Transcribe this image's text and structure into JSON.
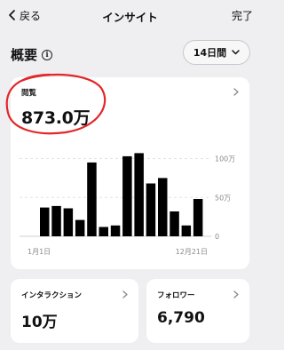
{
  "header": {
    "back_label": "戻る",
    "title": "インサイト",
    "done_label": "完了"
  },
  "section": {
    "title": "概要",
    "range_label": "14日間"
  },
  "views_card": {
    "label": "閲覧",
    "value": "873.0万",
    "annotation_color": "#e3262a",
    "chart_data": {
      "type": "bar",
      "ylim": [
        0,
        120
      ],
      "y_ticks": [
        "100万",
        "50万",
        "0"
      ],
      "y_tick_values": [
        100,
        50,
        0
      ],
      "x_tick_labels": [
        "1月1日",
        "12月21日"
      ],
      "values": [
        37,
        39,
        36,
        21,
        95,
        12,
        14,
        103,
        107,
        68,
        75,
        32,
        14,
        48
      ],
      "bar_color": "#000000",
      "grid": "dashed"
    }
  },
  "interactions_card": {
    "label": "インタラクション",
    "value": "10万"
  },
  "followers_card": {
    "label": "フォロワー",
    "value": "6,790"
  }
}
